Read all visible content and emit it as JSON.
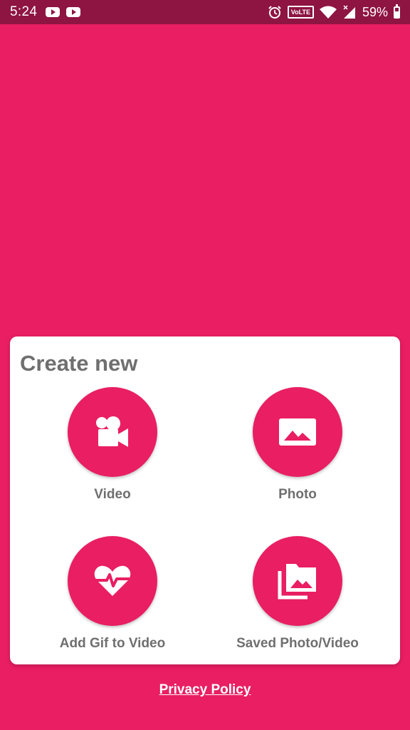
{
  "status_bar": {
    "time": "5:24",
    "volte_label": "VoLTE",
    "battery_percent": "59%",
    "battery_level": 0.59,
    "notification_icons": [
      "youtube-icon",
      "youtube-icon"
    ],
    "system_icons": [
      "alarm-icon",
      "volte-icon",
      "wifi-icon",
      "signal-icon",
      "battery-icon"
    ]
  },
  "create_new": {
    "title": "Create new",
    "options": [
      {
        "label": "Video",
        "icon": "video-camera-icon"
      },
      {
        "label": "Photo",
        "icon": "photo-icon"
      },
      {
        "label": "Add Gif to Video",
        "icon": "heart-pulse-icon"
      },
      {
        "label": "Saved Photo/Video",
        "icon": "photo-library-icon"
      }
    ]
  },
  "footer": {
    "privacy_policy": "Privacy Policy"
  },
  "colors": {
    "primary": "#E91E63",
    "status_bar": "#8E1442",
    "card_background": "#FFFFFF",
    "text_gray": "#6F6F6F"
  }
}
